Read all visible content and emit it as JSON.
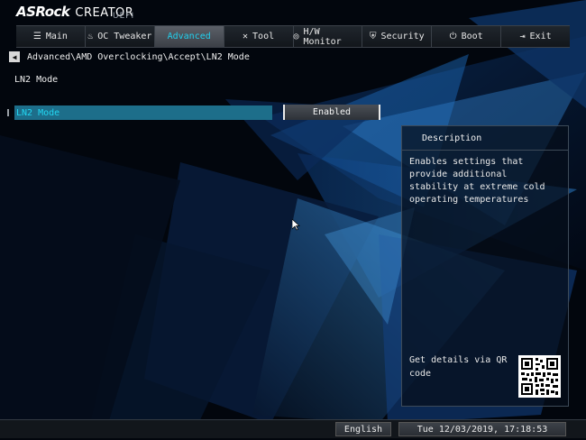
{
  "brand": {
    "name": "ASRock",
    "line": "CREATOR",
    "badge": "UEFI"
  },
  "nav": {
    "tabs": [
      {
        "label": "Main",
        "icon": "list-icon",
        "glyph": "☰",
        "active": false
      },
      {
        "label": "OC Tweaker",
        "icon": "flame-icon",
        "glyph": "♨",
        "active": false
      },
      {
        "label": "Advanced",
        "icon": "",
        "glyph": "",
        "active": true
      },
      {
        "label": "Tool",
        "icon": "tools-icon",
        "glyph": "✕",
        "active": false
      },
      {
        "label": "H/W Monitor",
        "icon": "monitor-icon",
        "glyph": "◎",
        "active": false
      },
      {
        "label": "Security",
        "icon": "shield-icon",
        "glyph": "⛨",
        "active": false
      },
      {
        "label": "Boot",
        "icon": "power-icon",
        "glyph": "⏻",
        "active": false
      },
      {
        "label": "Exit",
        "icon": "exit-icon",
        "glyph": "⇥",
        "active": false
      }
    ]
  },
  "breadcrumb": {
    "path": "Advanced\\AMD Overclocking\\Accept\\LN2 Mode",
    "back_icon": "back-arrow-icon"
  },
  "section": {
    "title": "LN2 Mode"
  },
  "settings": [
    {
      "label": "LN2 Mode",
      "value": "Enabled"
    }
  ],
  "description": {
    "title": "Description",
    "text": "Enables settings that provide additional stability at extreme cold operating temperatures",
    "qr_text": "Get details via QR code"
  },
  "status": {
    "language": "English",
    "datetime": "Tue 12/03/2019, 17:18:53"
  },
  "colors": {
    "accent": "#22d6f2",
    "selection": "#1d6e8a",
    "background": "#02060d"
  }
}
